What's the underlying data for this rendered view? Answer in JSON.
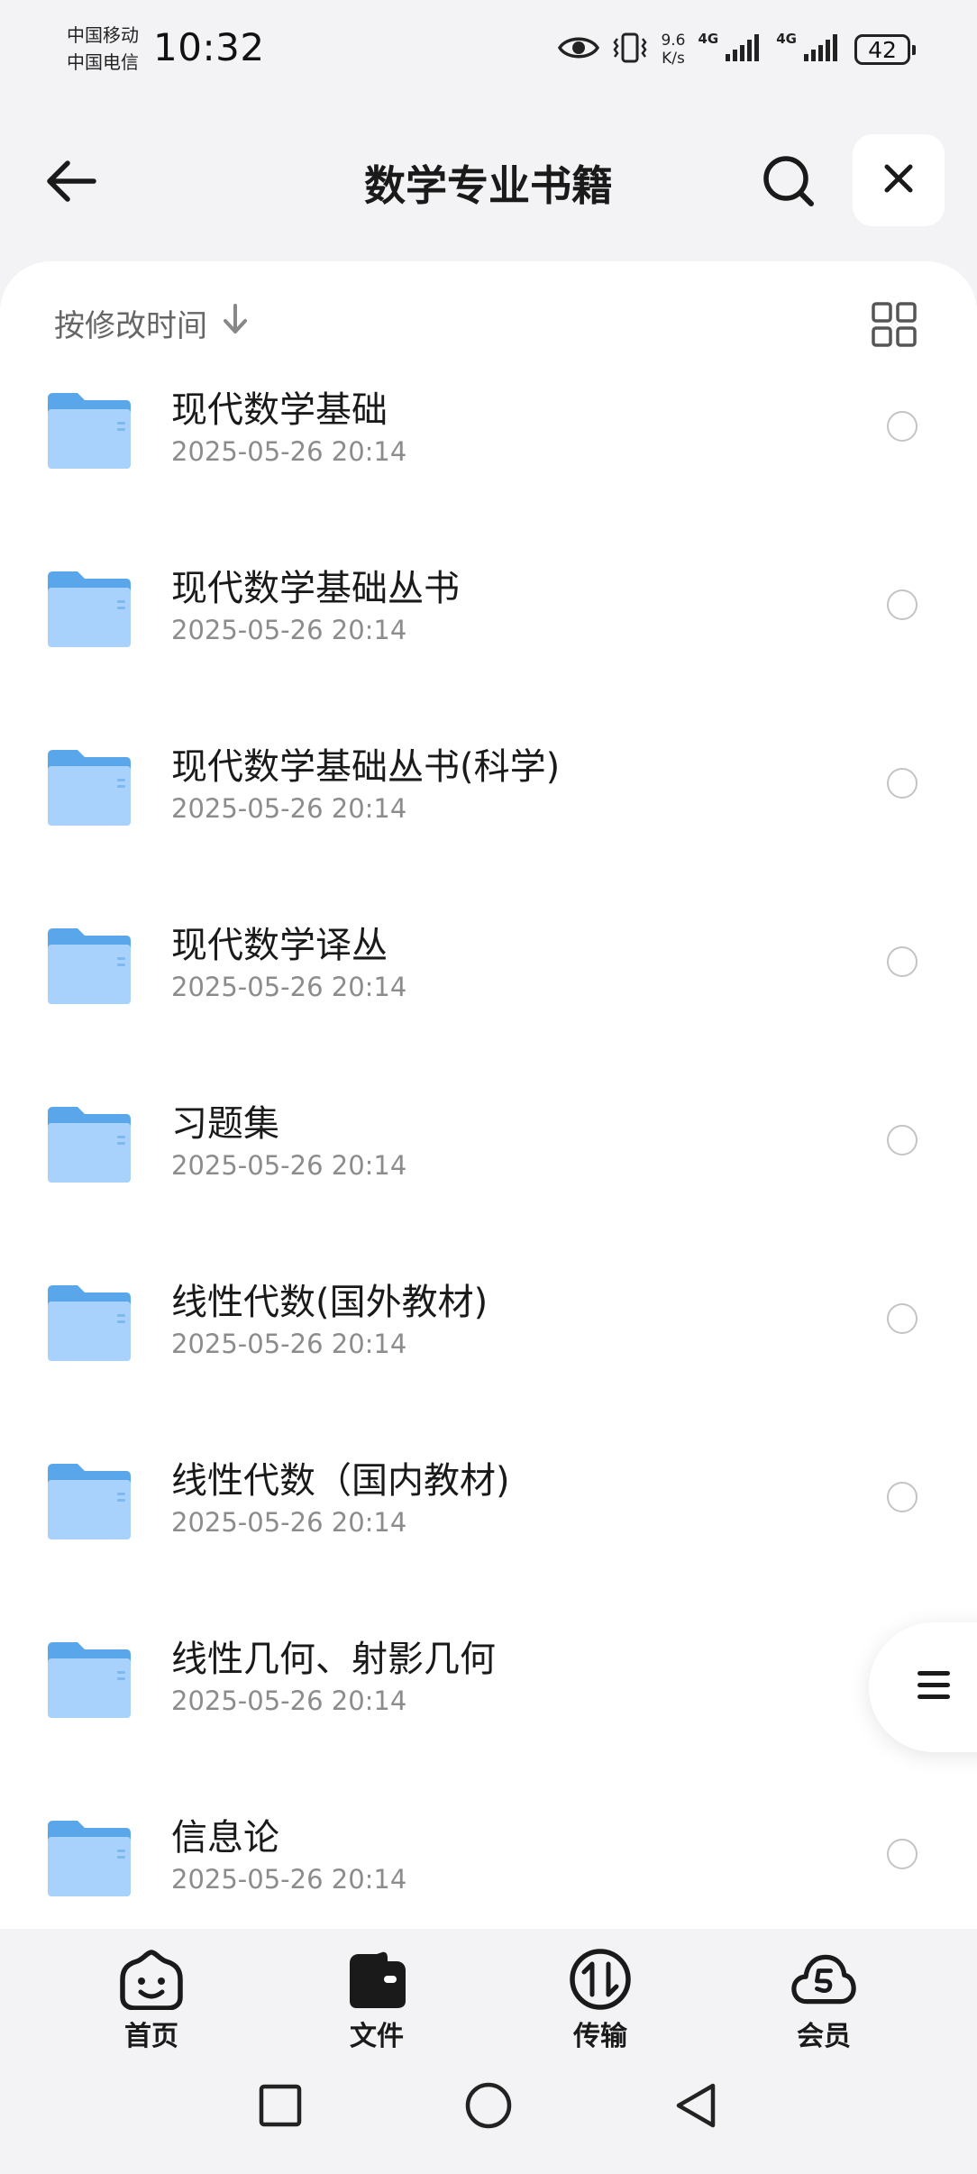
{
  "status_bar": {
    "carrier_1": "中国移动",
    "carrier_2": "中国电信",
    "time": "10:32",
    "net_speed_value": "9.6",
    "net_speed_unit": "K/s",
    "network_1": "4G",
    "network_2": "4G",
    "battery": "42",
    "icons": [
      "eye-icon",
      "vibrate-icon",
      "signal-icon",
      "signal-icon",
      "battery-icon"
    ]
  },
  "header": {
    "title": "数学专业书籍",
    "icons": [
      "back-arrow-icon",
      "search-icon",
      "close-icon"
    ]
  },
  "sort": {
    "label": "按修改时间",
    "icons": [
      "arrow-down-icon",
      "grid-view-icon"
    ]
  },
  "files": [
    {
      "name": "现代数学基础",
      "date": "2025-05-26 20:14"
    },
    {
      "name": "现代数学基础丛书",
      "date": "2025-05-26 20:14"
    },
    {
      "name": "现代数学基础丛书(科学)",
      "date": "2025-05-26 20:14"
    },
    {
      "name": "现代数学译丛",
      "date": "2025-05-26 20:14"
    },
    {
      "name": "习题集",
      "date": "2025-05-26 20:14"
    },
    {
      "name": "线性代数(国外教材)",
      "date": "2025-05-26 20:14"
    },
    {
      "name": "线性代数（国内教材)",
      "date": "2025-05-26 20:14"
    },
    {
      "name": "线性几何、射影几何",
      "date": "2025-05-26 20:14"
    },
    {
      "name": "信息论",
      "date": "2025-05-26 20:14"
    }
  ],
  "float_menu": {
    "icon": "menu-lines-icon"
  },
  "bottom_nav": [
    {
      "label": "首页",
      "icon": "smile-home-icon"
    },
    {
      "label": "文件",
      "icon": "wallet-file-icon"
    },
    {
      "label": "传输",
      "icon": "transfer-icon"
    },
    {
      "label": "会员",
      "icon": "cloud-member-icon"
    }
  ],
  "system_nav": [
    "recent-apps-icon",
    "home-icon",
    "back-icon"
  ],
  "colors": {
    "background": "#f3f3f5",
    "card": "#ffffff",
    "folder_back": "#5aa6ea",
    "folder_front": "#a8d1fb",
    "text_primary": "#1a1a1a",
    "text_secondary": "#8c8c8c"
  }
}
